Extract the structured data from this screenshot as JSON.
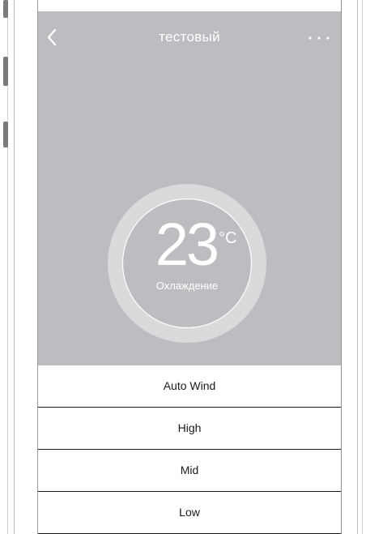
{
  "header": {
    "title": "тестовый"
  },
  "icons": {
    "back": "chevron-left-icon",
    "more": "more-horizontal-icon"
  },
  "thermostat": {
    "temperature": "23",
    "unit": "°C",
    "mode": "Охлаждение"
  },
  "fan_options": [
    "Auto Wind",
    "High",
    "Mid",
    "Low"
  ],
  "colors": {
    "background_panel": "#bcbdc0",
    "ring": "#d9dadc",
    "text_light": "#ffffff",
    "text_dark": "#1a1a1a"
  }
}
